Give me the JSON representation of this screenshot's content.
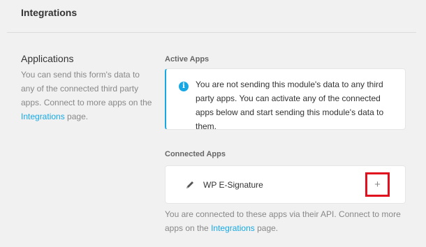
{
  "header": {
    "title": "Integrations"
  },
  "applications": {
    "heading": "Applications",
    "description_part1": "You can send this form's data to any of the connected third party apps. Connect to more apps on the ",
    "link_label": "Integrations",
    "description_part2": " page."
  },
  "active_apps": {
    "label": "Active Apps",
    "notice": "You are not sending this module's data to any third party apps. You can activate any of the connected apps below and start sending this module's data to them."
  },
  "connected_apps": {
    "label": "Connected Apps",
    "apps": [
      {
        "name": "WP E-Signature",
        "icon": "pencil-icon",
        "action_label": "+"
      }
    ],
    "footer_part1": "You are connected to these apps via their API. Connect to more apps on the ",
    "footer_link": "Integrations",
    "footer_part2": " page."
  },
  "colors": {
    "accent": "#17a8e3",
    "highlight": "#e0101e",
    "background": "#f1f1f1"
  }
}
